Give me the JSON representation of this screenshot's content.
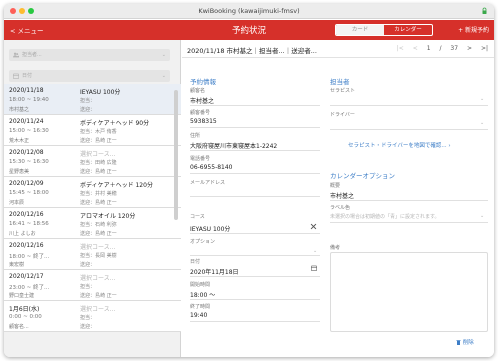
{
  "window": {
    "title": "KwiBooking (kawaijimuki-fmsv)"
  },
  "header": {
    "menu_label": "< メニュー",
    "title": "予約状況",
    "seg_card": "カード",
    "seg_calendar": "カレンダー",
    "new_label": "+ 新規予約"
  },
  "filters": {
    "person_placeholder": "担当者...",
    "date_placeholder": "日付"
  },
  "list": [
    {
      "date": "2020/11/18",
      "time": "18:00 ~ 19:40",
      "customer": "市村基之",
      "course": "IEYASU 100分",
      "muted": false,
      "staff": "担当：",
      "driver": "送迎：",
      "selected": true
    },
    {
      "date": "2020/11/24",
      "time": "15:00 ~ 16:30",
      "customer": "荒木木正",
      "course": "ボディケア＋ヘッド 90分",
      "muted": false,
      "staff": "担当：木戸 侑香",
      "driver": "送迎：島崎 正一",
      "selected": false
    },
    {
      "date": "2020/12/08",
      "time": "15:30 ~ 16:30",
      "customer": "星野恵美",
      "course": "選択コース...",
      "muted": true,
      "staff": "担当：田崎 広隆",
      "driver": "送迎：島崎 正一",
      "selected": false
    },
    {
      "date": "2020/12/09",
      "time": "15:45 ~ 18:00",
      "customer": "河本辰",
      "course": "ボディケア＋ヘッド 120分",
      "muted": false,
      "staff": "担当：井村 美穂",
      "driver": "送迎：島崎 正一",
      "selected": false
    },
    {
      "date": "2020/12/16",
      "time": "16:41 ~ 18:56",
      "customer": "川上 よしお",
      "course": "アロマオイル 120分",
      "muted": false,
      "staff": "担当：石崎 利弥",
      "driver": "送迎：島崎 正一",
      "selected": false
    },
    {
      "date": "2020/12/16",
      "time": "18:00 ~ 終了...",
      "customer": "東宏樹",
      "course": "選択コース...",
      "muted": true,
      "staff": "担当：長岡 美樹",
      "driver": "送迎：",
      "selected": false
    },
    {
      "date": "2020/12/17",
      "time": "23:00 ~ 終了...",
      "customer": "野口皇士建",
      "course": "選択コース...",
      "muted": true,
      "staff": "担当：",
      "driver": "送迎：島崎 正一",
      "selected": false
    },
    {
      "date": "1月6日(水)",
      "time": "0:00 ~ 0:00",
      "customer": "顧客名...",
      "course": "選択コース...",
      "muted": true,
      "staff": "担当：",
      "driver": "送迎：",
      "selected": false
    }
  ],
  "detail": {
    "title": "2020/11/18 市村基之｜担当者...｜送迎者...",
    "pager": {
      "first": "|<",
      "prev": "<",
      "current": "1",
      "sep": "/",
      "total": "37",
      "next": ">",
      "last": ">|"
    },
    "booking_section": "予約情報",
    "customer_label": "顧客名",
    "customer_value": "市村基之",
    "customer_no_label": "顧客番号",
    "customer_no_value": "5938315",
    "address_label": "住所",
    "address_value": "大阪府寝屋川市東寝屋本1-2242",
    "phone_label": "電話番号",
    "phone_value": "06-6955-8140",
    "email_label": "メールアドレス",
    "course_label": "コース",
    "course_value": "IEYASU 100分",
    "option_label": "オプション",
    "date_label": "日付",
    "date_value": "2020年11月18日",
    "start_label": "開始時間",
    "start_value": "18:00 〜",
    "end_label": "終了時間",
    "end_value": "19:40",
    "staff_section": "担当者",
    "therapist_label": "セラピスト",
    "driver_label": "ドライバー",
    "map_link": "セラピスト・ドライバーを地図で確認...",
    "calendar_section": "カレンダーオプション",
    "summary_label": "概要",
    "summary_value": "市村基之",
    "color_label": "ラベル色",
    "color_placeholder": "未選択の場合は初期値の「青」に設定されます。",
    "memo_label": "備考",
    "delete_label": "削除"
  }
}
